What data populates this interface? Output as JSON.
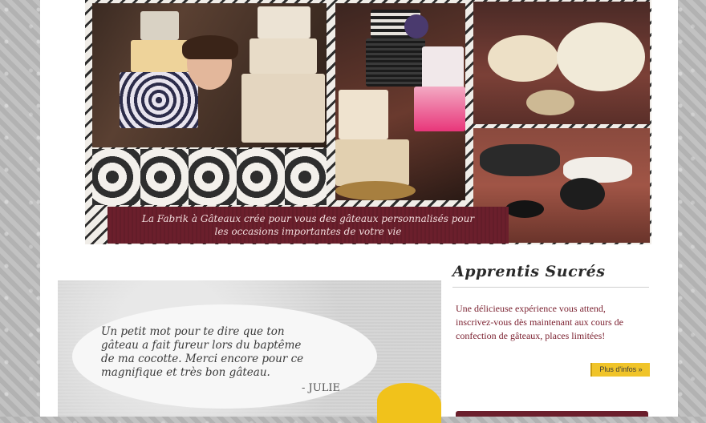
{
  "banner": {
    "line1": "La Fabrik à Gâteaux crée pour vous des gâteaux personnalisés pour",
    "line2": "les occasions importantes de votre vie"
  },
  "testimonial": {
    "quote_lines": [
      "Un petit mot pour te dire que ton",
      "gâteau a fait fureur lors du baptême",
      "de ma cocotte. Merci encore pour ce",
      "magnifique et très bon gâteau."
    ],
    "author": "- JULIE"
  },
  "sidebar": {
    "title": "Apprentis Sucrés",
    "text": "Une délicieuse expérience vous attend, inscrivez-vous dès maintenant aux cours de confection de gâteaux, places limitées!",
    "more_label": "Plus d'infos »"
  },
  "colors": {
    "accent_wine": "#6b1f2c",
    "accent_yellow": "#f0c42a"
  }
}
